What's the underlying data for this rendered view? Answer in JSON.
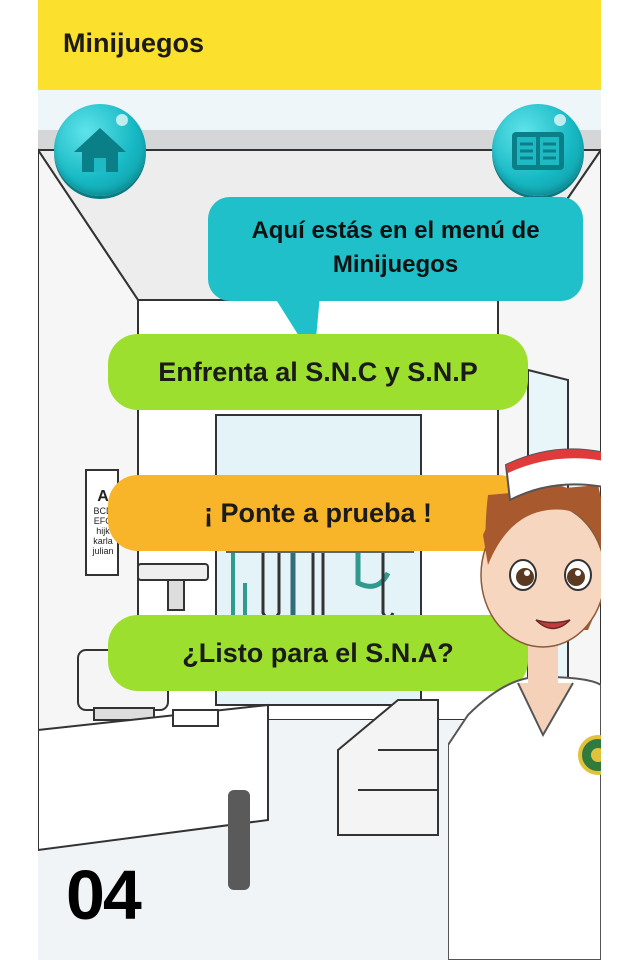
{
  "appbar": {
    "title": "Minijuegos"
  },
  "icons": {
    "home": "home-icon",
    "book": "book-icon"
  },
  "speech_bubble": {
    "line1": "Aquí estás en el menú de",
    "line2": "Minijuegos"
  },
  "menu": {
    "items": [
      {
        "label": "Enfrenta al S.N.C y S.N.P",
        "color": "#9cdf2e"
      },
      {
        "label": "¡ Ponte a prueba !",
        "color": "#f8b52a"
      },
      {
        "label": "¿Listo para el S.N.A?",
        "color": "#9cdf2e"
      }
    ]
  },
  "eye_chart": {
    "text": [
      "A",
      "BCD",
      "EFG",
      "hijk",
      "karla",
      "julian"
    ]
  },
  "page_number": "04",
  "colors": {
    "appbar": "#fbe02e",
    "accent": "#1fc0c9",
    "green_button": "#9cdf2e",
    "orange_button": "#f8b52a"
  }
}
